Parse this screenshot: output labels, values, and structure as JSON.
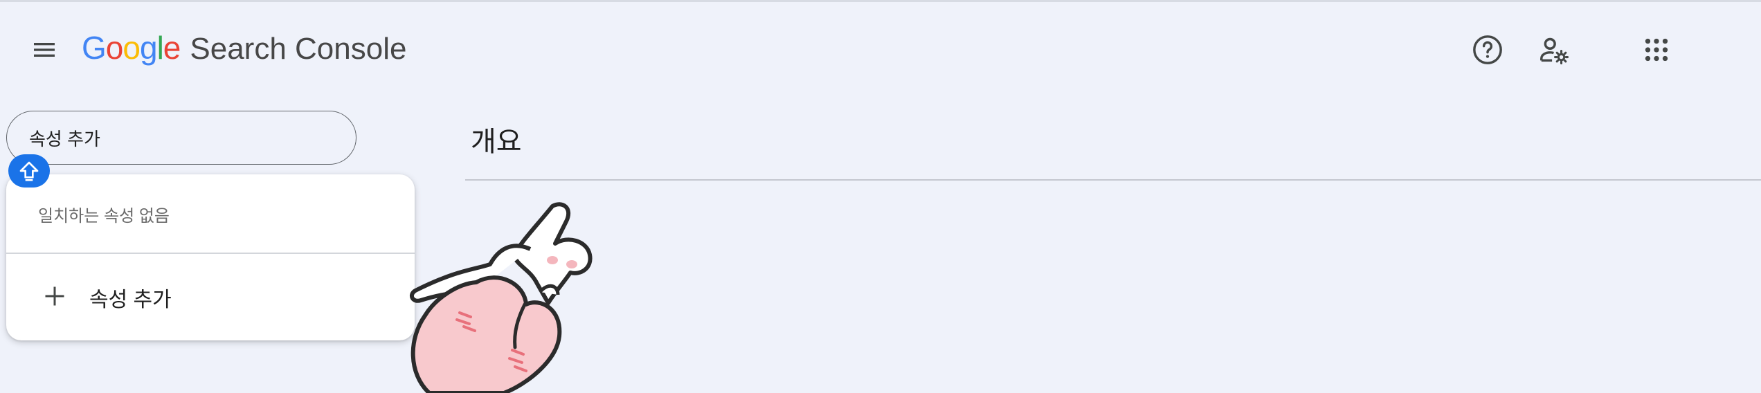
{
  "header": {
    "logo_text": "Google",
    "product_name": "Search Console",
    "menu_icon": "hamburger-menu-icon",
    "help_icon": "help-circle-icon",
    "account_icon": "manage-users-icon",
    "apps_icon": "google-apps-grid-icon"
  },
  "property_search": {
    "value": "속성 추가",
    "badge_icon": "shift-up-arrow-icon",
    "dropdown": {
      "empty_message": "일치하는 속성 없음",
      "add_label": "속성 추가",
      "add_icon": "plus-icon"
    }
  },
  "main": {
    "title": "개요"
  },
  "decoration": {
    "icon": "rabbit-heart-sticker"
  },
  "colors": {
    "background": "#eff2fa",
    "google_blue": "#4285F4",
    "google_red": "#EA4335",
    "google_yellow": "#FBBC05",
    "google_green": "#34A853",
    "badge_blue": "#1a73e8"
  }
}
